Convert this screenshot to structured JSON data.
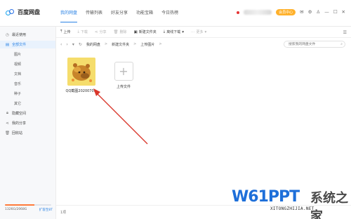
{
  "app": {
    "name": "百度网盘"
  },
  "nav": {
    "tabs": [
      {
        "label": "我的网盘"
      },
      {
        "label": "传输列表"
      },
      {
        "label": "好友分享"
      },
      {
        "label": "功能宝箱"
      },
      {
        "label": "今日热榜"
      }
    ]
  },
  "user": {
    "vip_label": "会员中心"
  },
  "sidebar": {
    "items": [
      {
        "label": "最近使用"
      },
      {
        "label": "全部文件"
      }
    ],
    "sub_items": [
      {
        "label": "图片"
      },
      {
        "label": "视频"
      },
      {
        "label": "文档"
      },
      {
        "label": "音乐"
      },
      {
        "label": "种子"
      },
      {
        "label": "其它"
      }
    ],
    "bottom_items": [
      {
        "label": "隐藏空间"
      },
      {
        "label": "我的分享"
      },
      {
        "label": "回收站"
      }
    ],
    "quota": {
      "used_text": "1326G/2068G",
      "expand_label": "扩容至8T",
      "fill_fraction": 0.63
    }
  },
  "toolbar": {
    "upload": "上传",
    "download": "下载",
    "share": "分享",
    "delete": "删除",
    "new_folder": "新建文件夹",
    "offline_download": "离线下载",
    "more": "更多"
  },
  "path": {
    "crumbs": [
      "我的网盘",
      "新建文件夹",
      "上传图片"
    ],
    "search_placeholder": "搜索我的网盘文件"
  },
  "files": [
    {
      "name": "QQ截图2020070..."
    }
  ],
  "upload_tile": {
    "label": "上传文件"
  },
  "status": {
    "count": "1项"
  },
  "watermark": {
    "logo": "W61PPT",
    "subtitle": "XITONGZHIJIA.NET",
    "cn": "系统之家"
  },
  "colors": {
    "accent": "#2a82e4",
    "arrow": "#d9362b",
    "vip": "#ffb12b",
    "quota": "#ff7b3a"
  }
}
